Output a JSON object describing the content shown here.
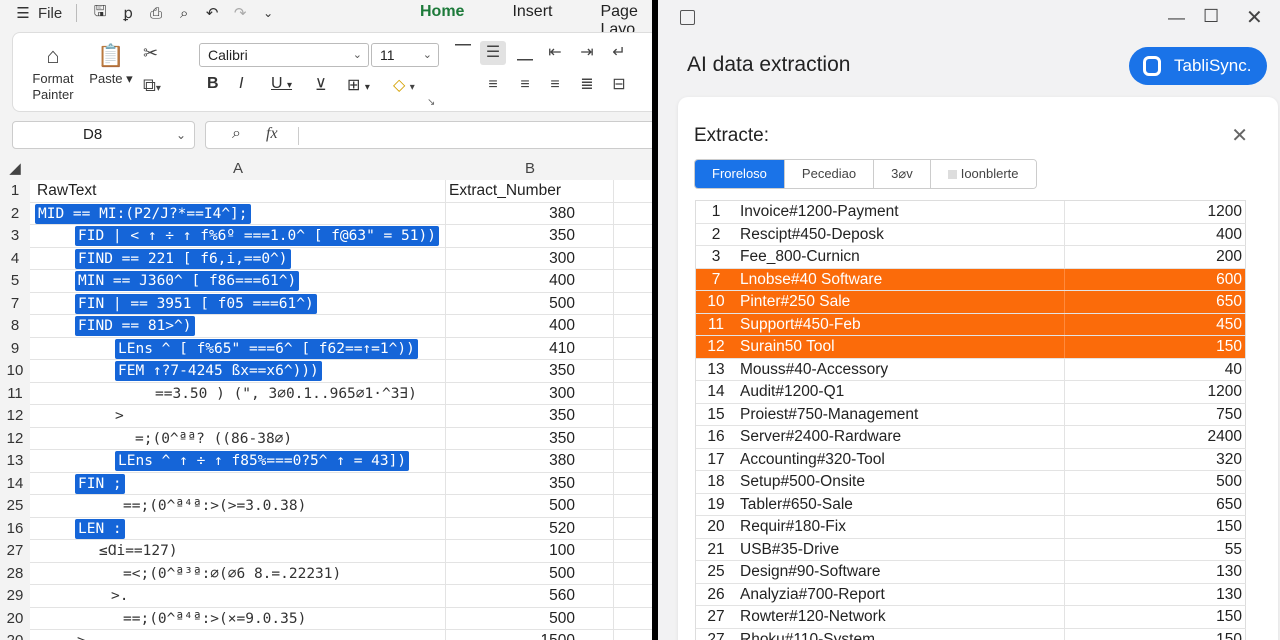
{
  "excel": {
    "menu": {
      "file": "File",
      "tabs": [
        "Home",
        "Insert",
        "Page Layo"
      ]
    },
    "ribbon": {
      "format_painter": "Format\nPainter",
      "paste": "Paste",
      "font_name": "Calibri",
      "font_size": "11"
    },
    "name_box": "D8",
    "formula_fx": "fx",
    "columns": [
      "A",
      "B"
    ],
    "header_row": {
      "a": "RawText",
      "b": "Extract_Number"
    },
    "rows": [
      {
        "n": "2",
        "text": "MID == MI:(P2/J?*==I4^];",
        "style": "hl",
        "indent": 0,
        "b": "380"
      },
      {
        "n": "3",
        "text": "FID | < ↑ ÷ ↑ f%6º ===1.0^ [ f@63\" = 51))",
        "style": "hl",
        "indent": 1,
        "b": "350"
      },
      {
        "n": "4",
        "text": "FIND == 221 [ f6,i,==0^)",
        "style": "hl",
        "indent": 1,
        "b": "300"
      },
      {
        "n": "5",
        "text": "MIN == J360^ [ f86===61^)",
        "style": "hl",
        "indent": 1,
        "b": "400"
      },
      {
        "n": "7",
        "text": "FIN | == 3951 [ f05 ===61^)",
        "style": "hl",
        "indent": 1,
        "b": "500"
      },
      {
        "n": "8",
        "text": "FIND == 81>^)",
        "style": "hl",
        "indent": 1,
        "b": "400"
      },
      {
        "n": "9",
        "text": "LEns ^ [ f%65\" ===6^ [ f62==↑=1^))",
        "style": "hl",
        "indent": 2,
        "b": "410"
      },
      {
        "n": "10",
        "text": "FEM ↑?7-4245 ßx==x6^)))",
        "style": "hl",
        "indent": 2,
        "b": "350"
      },
      {
        "n": "11",
        "text": "==3.50 ) (\", 3⌀0.1..965⌀1·^3∃)",
        "style": "plain",
        "indent": 3,
        "b": "300"
      },
      {
        "n": "12",
        "text": ">",
        "style": "plain",
        "indent": 2,
        "b": "350"
      },
      {
        "n": "12",
        "text": "=;(0^ªª? ((86-38⌀)",
        "style": "plain",
        "indent": 2.5,
        "b": "350"
      },
      {
        "n": "13",
        "text": "LEns ^ ↑ ÷ ↑ f85%===0?5^ ↑ = 43])",
        "style": "hl",
        "indent": 2,
        "b": "380"
      },
      {
        "n": "14",
        "text": "FIN ;",
        "style": "hl",
        "indent": 1,
        "b": "350"
      },
      {
        "n": "25",
        "text": "==;(0^ª⁴ª:>(>=3.0.38)",
        "style": "plain",
        "indent": 2.2,
        "b": "500"
      },
      {
        "n": "16",
        "text": "LEN :",
        "style": "hl",
        "indent": 1,
        "b": "520"
      },
      {
        "n": "27",
        "text": "≤Ɑi==127)",
        "style": "plain",
        "indent": 1.6,
        "b": "100"
      },
      {
        "n": "28",
        "text": "=<;(0^ª³ª:⌀(⌀6 8.=.22231)",
        "style": "plain",
        "indent": 2.2,
        "b": "500"
      },
      {
        "n": "29",
        "text": ">.",
        "style": "plain",
        "indent": 1.9,
        "b": "560"
      },
      {
        "n": "20",
        "text": "==;(0^ª⁴ª:>(×=9.0.35)",
        "style": "plain",
        "indent": 2.2,
        "b": "500"
      },
      {
        "n": "20",
        "text": ">",
        "style": "plain",
        "indent": 1.05,
        "b": "1500"
      }
    ]
  },
  "panel": {
    "title": "AI data extraction",
    "brand": "TabliSync.",
    "card_title": "Extracte:",
    "segments": [
      "Froreloso",
      "Pecediao",
      "3⌀v",
      "Ioonblerte"
    ],
    "active_segment": 0,
    "accent": "#1a73e8",
    "highlight": "#fb6b0a",
    "rows": [
      {
        "i": "1",
        "name": "Invoice#1200-Payment",
        "value": "1200",
        "hi": false
      },
      {
        "i": "2",
        "name": "Rescipt#450-Deposk",
        "value": "400",
        "hi": false
      },
      {
        "i": "3",
        "name": "Fee_800-Curnicn",
        "value": "200",
        "hi": false
      },
      {
        "i": "7",
        "name": "Lnobse#40 Software",
        "value": "600",
        "hi": true
      },
      {
        "i": "10",
        "name": "Pinter#250 Sale",
        "value": "650",
        "hi": true
      },
      {
        "i": "11",
        "name": "Support#450-Feb",
        "value": "450",
        "hi": true
      },
      {
        "i": "12",
        "name": "Surain50 Tool",
        "value": "150",
        "hi": true
      },
      {
        "i": "13",
        "name": "Mouss#40-Accessory",
        "value": "40",
        "hi": false
      },
      {
        "i": "14",
        "name": "Audit#1200-Q1",
        "value": "1200",
        "hi": false
      },
      {
        "i": "15",
        "name": "Proiest#750-Management",
        "value": "750",
        "hi": false
      },
      {
        "i": "16",
        "name": "Server#2400-Rardware",
        "value": "2400",
        "hi": false
      },
      {
        "i": "17",
        "name": "Accounting#320-Tool",
        "value": "320",
        "hi": false
      },
      {
        "i": "18",
        "name": "Setup#500-Onsite",
        "value": "500",
        "hi": false
      },
      {
        "i": "19",
        "name": "Tabler#650-Sale",
        "value": "650",
        "hi": false
      },
      {
        "i": "20",
        "name": "Requir#180-Fix",
        "value": "150",
        "hi": false
      },
      {
        "i": "21",
        "name": "USB#35-Drive",
        "value": "55",
        "hi": false
      },
      {
        "i": "25",
        "name": "Design#90-Software",
        "value": "130",
        "hi": false
      },
      {
        "i": "26",
        "name": "Analyzia#700-Report",
        "value": "130",
        "hi": false
      },
      {
        "i": "27",
        "name": "Rowter#120-Network",
        "value": "150",
        "hi": false
      },
      {
        "i": "27",
        "name": "Rhoku#110-System",
        "value": "150",
        "hi": false
      }
    ]
  }
}
